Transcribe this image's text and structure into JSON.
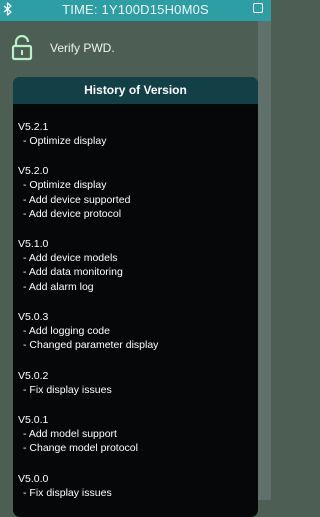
{
  "status_bar": {
    "time_label": "TIME: 1Y100D15H0M0S"
  },
  "verify": {
    "label": "Verify PWD."
  },
  "history": {
    "title": "History of Version",
    "versions": [
      {
        "version": "V5.2.1",
        "changes": [
          "- Optimize display"
        ]
      },
      {
        "version": "V5.2.0",
        "changes": [
          "- Optimize display",
          "- Add device supported",
          "- Add device protocol"
        ]
      },
      {
        "version": "V5.1.0",
        "changes": [
          "- Add device models",
          "- Add data monitoring",
          "- Add alarm log"
        ]
      },
      {
        "version": "V5.0.3",
        "changes": [
          "- Add logging code",
          "- Changed parameter display"
        ]
      },
      {
        "version": "V5.0.2",
        "changes": [
          "- Fix display issues"
        ]
      },
      {
        "version": "V5.0.1",
        "changes": [
          "- Add model support",
          "- Change model protocol"
        ]
      },
      {
        "version": "V5.0.0",
        "changes": [
          "- Fix display issues"
        ]
      }
    ]
  },
  "colors": {
    "topbar": "#2c9ea4",
    "panel_header": "#134046",
    "panel_body": "#060708",
    "lock_icon": "#b8f0c8"
  },
  "icons": {
    "bluetooth": "bluetooth-icon",
    "lock": "lock-icon",
    "menu": "menu-icon"
  }
}
